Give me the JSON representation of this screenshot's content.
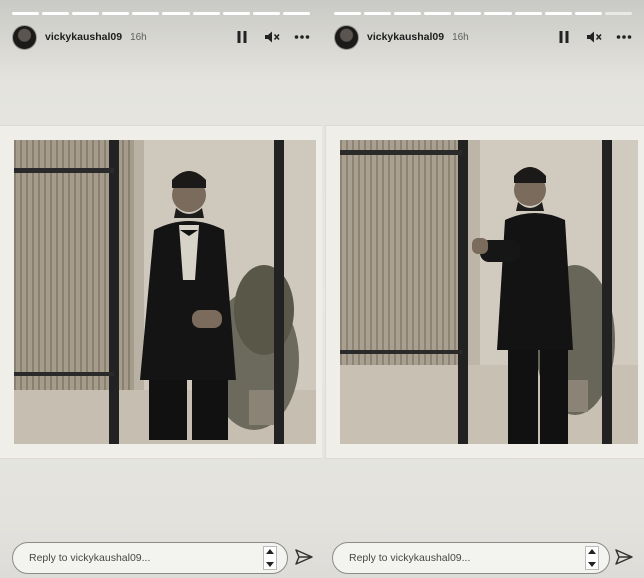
{
  "stories": [
    {
      "username": "vickykaushal09",
      "time": "16h",
      "reply_placeholder": "Reply to vickykaushal09...",
      "progress_done": 10,
      "progress_total": 10
    },
    {
      "username": "vickykaushal09",
      "time": "16h",
      "reply_placeholder": "Reply to vickykaushal09...",
      "progress_done": 9,
      "progress_total": 10
    }
  ],
  "icons": {
    "pause": "pause-icon",
    "mute": "mute-icon",
    "more": "more-icon",
    "send": "send-icon"
  },
  "colors": {
    "story_bg": "#e8e7e2",
    "progress": "#ffffff",
    "photo_tone": "#bdb8ad"
  }
}
